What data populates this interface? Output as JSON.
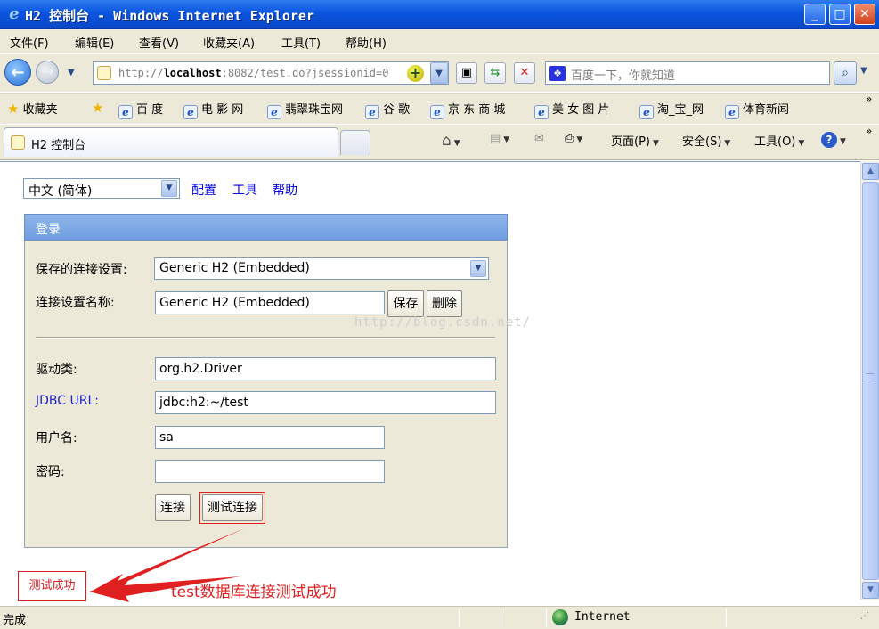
{
  "window": {
    "title": "H2 控制台 - Windows Internet Explorer"
  },
  "menu": [
    "文件(F)",
    "编辑(E)",
    "查看(V)",
    "收藏夹(A)",
    "工具(T)",
    "帮助(H)"
  ],
  "address": {
    "scheme": "http://",
    "host": "localhost",
    "rest": ":8082/test.do?jsessionid=0"
  },
  "search": {
    "placeholder": "百度一下，你就知道"
  },
  "favorites": {
    "label": "收藏夹",
    "items": [
      "百 度",
      "电 影 网",
      "翡翠珠宝网",
      "谷 歌",
      "京 东 商 城",
      "美 女 图 片",
      "淘_宝_网",
      "体育新闻"
    ]
  },
  "tab": {
    "title": "H2 控制台"
  },
  "commands": {
    "page": "页面(P)",
    "safety": "安全(S)",
    "tools": "工具(O)"
  },
  "lang": {
    "selected": "中文 (简体)"
  },
  "links": {
    "prefs": "配置",
    "tools": "工具",
    "help": "帮助"
  },
  "login": {
    "title": "登录",
    "saved_label": "保存的连接设置:",
    "saved_value": "Generic H2 (Embedded)",
    "name_label": "连接设置名称:",
    "name_value": "Generic H2 (Embedded)",
    "save_btn": "保存",
    "remove_btn": "删除",
    "driver_label": "驱动类:",
    "driver_value": "org.h2.Driver",
    "url_label": "JDBC URL:",
    "url_value": "jdbc:h2:~/test",
    "user_label": "用户名:",
    "user_value": "sa",
    "pass_label": "密码:",
    "pass_value": "",
    "connect_btn": "连接",
    "test_btn": "测试连接"
  },
  "watermark": "http://blog.csdn.net/",
  "result": {
    "text": "测试成功",
    "annotation": "test数据库连接测试成功"
  },
  "status": {
    "text": "完成",
    "zone": "Internet"
  },
  "colors": {
    "accent": "#e02020",
    "link": "#0000ee",
    "jdbc_label": "#2222cc",
    "panel": "#ece9d8",
    "panel_header": "#7aa7e6"
  }
}
